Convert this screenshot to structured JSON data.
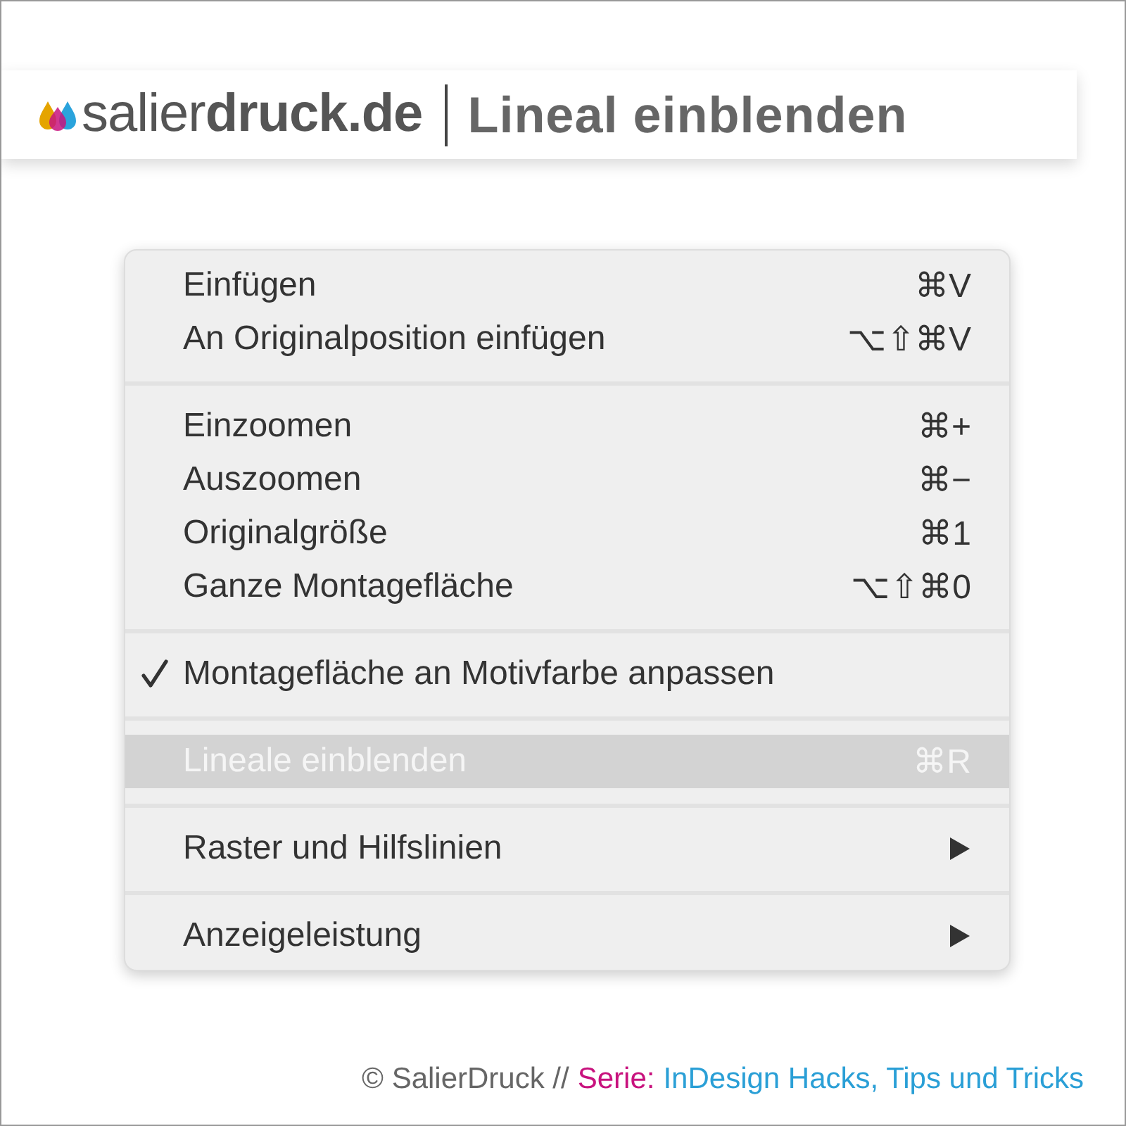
{
  "header": {
    "brand": "salier**druck.de**",
    "title": "Lineal einblenden"
  },
  "menu": {
    "groups": [
      {
        "items": [
          {
            "kind": "item",
            "label": "Einfügen",
            "shortcut": "⌘V",
            "checked": false,
            "selected": false
          },
          {
            "kind": "item",
            "label": "An Originalposition einfügen",
            "shortcut": "⌥⇧⌘V",
            "checked": false,
            "selected": false
          }
        ]
      },
      {
        "items": [
          {
            "kind": "item",
            "label": "Einzoomen",
            "shortcut": "⌘+",
            "checked": false,
            "selected": false
          },
          {
            "kind": "item",
            "label": "Auszoomen",
            "shortcut": "⌘−",
            "checked": false,
            "selected": false
          },
          {
            "kind": "item",
            "label": "Originalgröße",
            "shortcut": "⌘1",
            "checked": false,
            "selected": false
          },
          {
            "kind": "item",
            "label": "Ganze Montagefläche",
            "shortcut": "⌥⇧⌘0",
            "checked": false,
            "selected": false
          }
        ]
      },
      {
        "items": [
          {
            "kind": "item",
            "label": "Montagefläche an Motivfarbe anpassen",
            "checked": true,
            "selected": false
          }
        ]
      },
      {
        "items": [
          {
            "kind": "item",
            "label": "Lineale einblenden",
            "shortcut": "⌘R",
            "checked": false,
            "selected": true
          }
        ]
      },
      {
        "items": [
          {
            "kind": "submenu",
            "label": "Raster und Hilfslinien",
            "checked": false,
            "selected": false
          }
        ]
      },
      {
        "items": [
          {
            "kind": "submenu",
            "label": "Anzeigeleistung",
            "checked": false,
            "selected": false
          }
        ]
      }
    ]
  },
  "footer": [
    {
      "text": "© SalierDruck //",
      "color": "#666666"
    },
    {
      "text": "Serie:",
      "color": "#c8137e"
    },
    {
      "text": "InDesign Hacks, Tips und Tricks",
      "color": "#2a9fd6"
    }
  ]
}
